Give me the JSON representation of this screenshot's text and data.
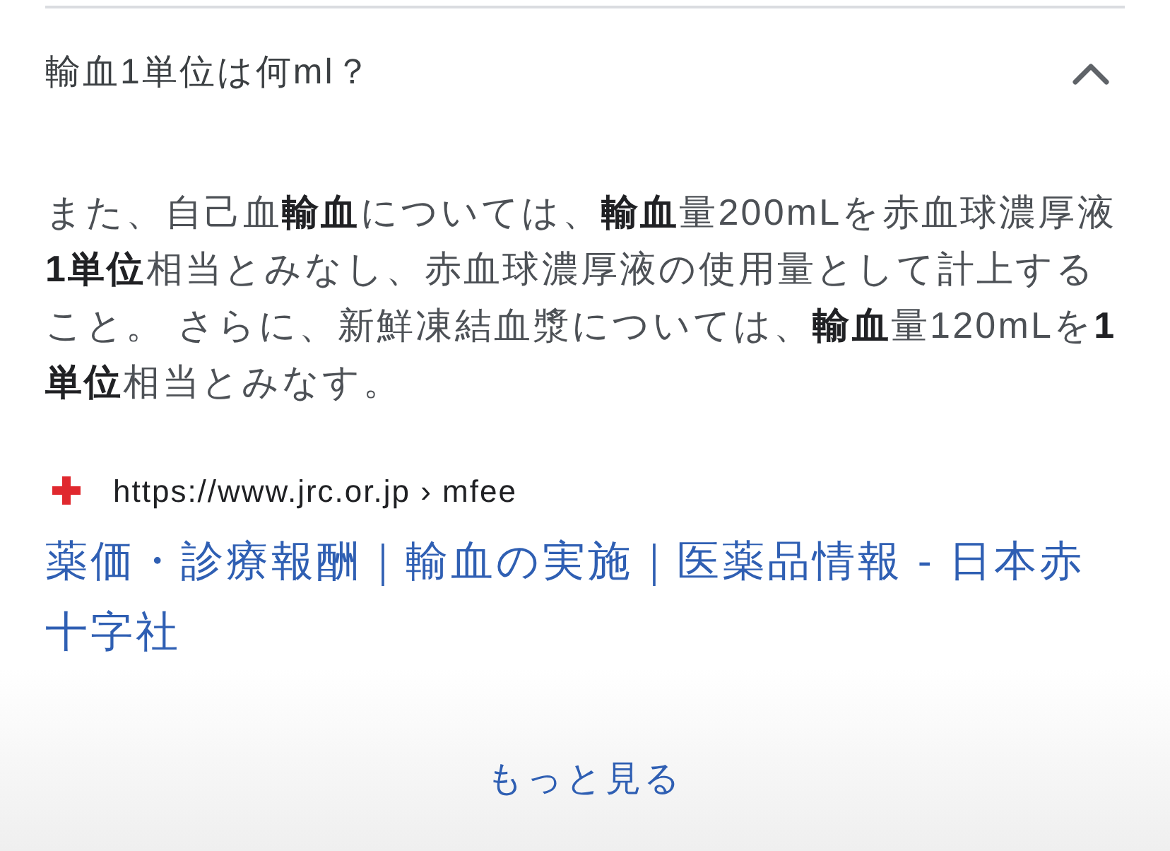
{
  "accordion": {
    "question": "輸血1単位は何ml？",
    "expanded": true
  },
  "answer": "また、自己血**輸血**については、**輸血**量200mLを赤血球濃厚液**1単位**相当とみなし、赤血球濃厚液の使用量として計上すること。 さらに、新鮮凍結血漿については、**輸血**量120mLを**1単位**相当とみなす。",
  "source": {
    "url": "https://www.jrc.or.jp › mfee",
    "title": "薬価・診療報酬｜輸血の実施｜医薬品情報 - 日本赤十字社"
  },
  "more_button": "もっと見る"
}
